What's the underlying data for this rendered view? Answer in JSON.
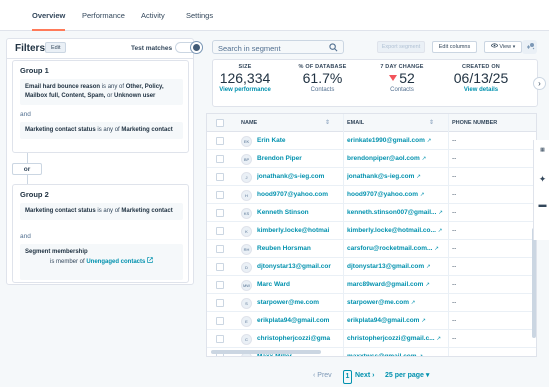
{
  "tabs": [
    {
      "label": "Overview"
    },
    {
      "label": "Performance"
    },
    {
      "label": "Activity"
    },
    {
      "label": "Settings"
    }
  ],
  "filters": {
    "title": "Filters",
    "edit_label": "Edit",
    "test_matches_label": "Test matches",
    "groups": [
      {
        "title": "Group 1",
        "cond1_field": "Email hard bounce reason",
        "cond1_text": " is any of ",
        "cond1_values": "Other, Policy, Mailbox full, Content, Spam, ",
        "cond1_or": "or ",
        "cond1_last": "Unknown user",
        "and_label": "and",
        "cond2_field": "Marketing contact status",
        "cond2_text": " is any of ",
        "cond2_values": "Marketing contact"
      },
      {
        "title": "Group 2",
        "cond1_field": "Marketing contact status",
        "cond1_text": " is any of ",
        "cond1_values": "Marketing contact",
        "and_label": "and",
        "cond2_field": "Segment membership",
        "cond2_text": "is member of ",
        "cond2_values": "Unengaged contacts"
      }
    ],
    "or_label": "or"
  },
  "search": {
    "placeholder": "Search in segment"
  },
  "toolbar": {
    "export_label": "Export segment",
    "edit_columns_label": "Edit columns",
    "view_label": "View"
  },
  "stats": [
    {
      "label": "SIZE",
      "value": "126,334",
      "sub": "View performance"
    },
    {
      "label": "% OF DATABASE",
      "value": "61.7%",
      "sub": "Contacts"
    },
    {
      "label": "7 DAY CHANGE",
      "value": "52",
      "sub": "Contacts"
    },
    {
      "label": "CREATED ON",
      "value": "06/13/25",
      "sub": "View details"
    }
  ],
  "table": {
    "headers": {
      "name": "NAME",
      "email": "EMAIL",
      "phone": "PHONE NUMBER"
    },
    "rows": [
      {
        "initials": "EK",
        "name": "Erin Kate",
        "email": "erinkate1990@gmail.com",
        "phone": "--"
      },
      {
        "initials": "BP",
        "name": "Brendon Piper",
        "email": "brendonpiper@aol.com",
        "phone": "--"
      },
      {
        "initials": "J",
        "name": "jonathank@s-ieg.com",
        "email": "jonathank@s-ieg.com",
        "phone": "--"
      },
      {
        "initials": "H",
        "name": "hood9707@yahoo.com",
        "email": "hood9707@yahoo.com",
        "phone": "--"
      },
      {
        "initials": "KS",
        "name": "Kenneth Stinson",
        "email": "kenneth.stinson007@gmail...",
        "phone": "--"
      },
      {
        "initials": "K",
        "name": "kimberly.locke@hotmai",
        "email": "kimberly.locke@hotmail.co...",
        "phone": "--"
      },
      {
        "initials": "RH",
        "name": "Reuben Horsman",
        "email": "carsforu@rocketmail.com...",
        "phone": "--"
      },
      {
        "initials": "D",
        "name": "djtonystar13@gmail.cor",
        "email": "djtonystar13@gmail.com",
        "phone": "--"
      },
      {
        "initials": "MW",
        "name": "Marc Ward",
        "email": "marc89ward@gmail.com",
        "phone": "--"
      },
      {
        "initials": "S",
        "name": "starpower@me.com",
        "email": "starpower@me.com",
        "phone": "--"
      },
      {
        "initials": "E",
        "name": "erikplata94@gmail.com",
        "email": "erikplata94@gmail.com",
        "phone": "--"
      },
      {
        "initials": "C",
        "name": "christopherjcozzi@gma",
        "email": "christopherjcozzi@gmail.c...",
        "phone": "--"
      },
      {
        "initials": "MM",
        "name": "Maxx Miller",
        "email": "maxxtwss@gmail.com",
        "phone": "--"
      }
    ]
  },
  "pager": {
    "prev_label": "Prev",
    "page": "1",
    "next_label": "Next",
    "per_page_label": "25 per page"
  },
  "colors": {
    "accent": "#ff7a59",
    "link": "#0091ae",
    "negative": "#f2545b"
  }
}
